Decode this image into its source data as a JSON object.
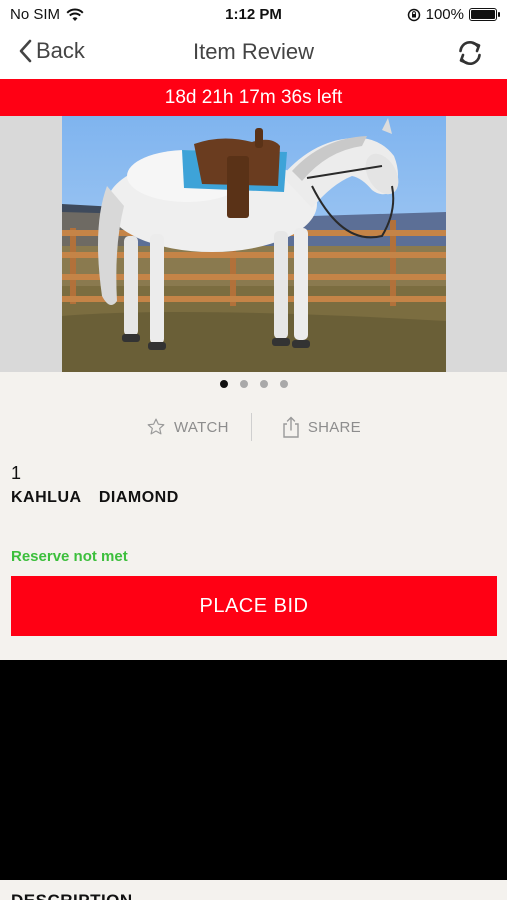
{
  "status_bar": {
    "carrier": "No SIM",
    "time": "1:12 PM",
    "battery": "100%"
  },
  "nav": {
    "back_label": "Back",
    "title": "Item Review"
  },
  "countdown": "18d 21h 17m 36s left",
  "gallery": {
    "image_count": 4,
    "active_index": 0
  },
  "actions": {
    "watch_label": "WATCH",
    "share_label": "SHARE"
  },
  "lot": {
    "number": "1",
    "name": "KAHLUA  DIAMOND",
    "reserve_status": "Reserve not met"
  },
  "bid_button_label": "PLACE BID",
  "description_header": "DESCRIPTION",
  "colors": {
    "accent_red": "#ff0014",
    "reserve_green": "#3cbf3c"
  }
}
